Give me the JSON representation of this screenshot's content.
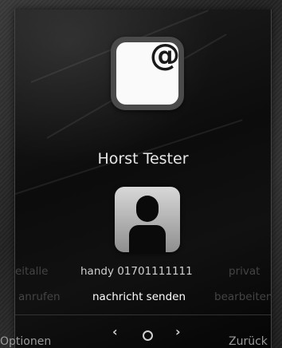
{
  "app_icon": {
    "symbol": "@",
    "icon": "at-sign-icon"
  },
  "contact": {
    "name": "Horst Tester",
    "avatar_icon": "person-icon"
  },
  "detail_row": {
    "left": "eitalle",
    "center": "handy 01701111111",
    "right": "privat"
  },
  "action_row": {
    "left": "anrufen",
    "center": "nachricht senden",
    "right": "bearbeiten"
  },
  "navigation": {
    "prev": "‹",
    "next": "›"
  },
  "softkeys": {
    "left": "Optionen",
    "right": "Zurück"
  }
}
